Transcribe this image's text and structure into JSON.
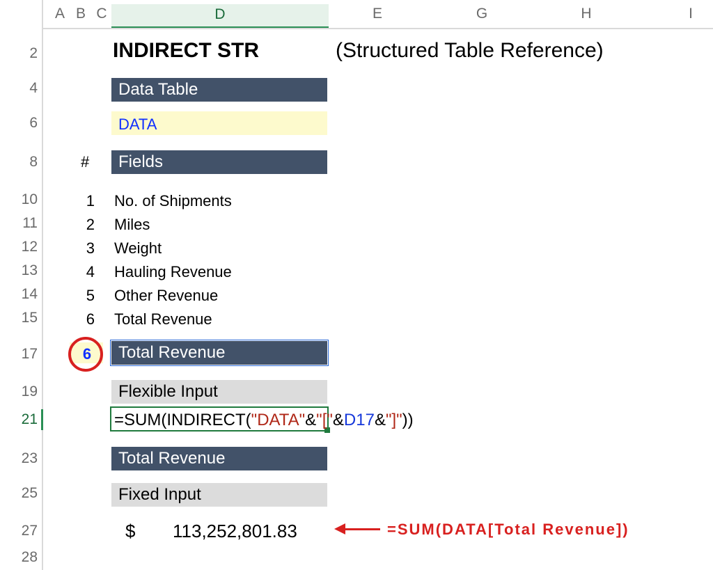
{
  "columns": {
    "A": "A",
    "B": "B",
    "C": "C",
    "D": "D",
    "E": "E",
    "G": "G",
    "H": "H",
    "I": "I"
  },
  "rows": {
    "r2": "2",
    "r4": "4",
    "r6": "6",
    "r8": "8",
    "r10": "10",
    "r11": "11",
    "r12": "12",
    "r13": "13",
    "r14": "14",
    "r15": "15",
    "r17": "17",
    "r19": "19",
    "r21": "21",
    "r23": "23",
    "r25": "25",
    "r27": "27",
    "r28": "28"
  },
  "title": {
    "bold": "INDIRECT STR",
    "regular": "(Structured Table Reference)"
  },
  "section": {
    "data_table": "Data Table",
    "data_name": "DATA",
    "fields_hdr": "Fields",
    "fields_num_hdr": "#"
  },
  "fields": {
    "nums": {
      "n1": "1",
      "n2": "2",
      "n3": "3",
      "n4": "4",
      "n5": "5",
      "n6": "6"
    },
    "items": {
      "f1": "No. of Shipments",
      "f2": "Miles",
      "f3": "Weight",
      "f4": "Hauling Revenue",
      "f5": "Other Revenue",
      "f6": "Total Revenue"
    }
  },
  "selected_field_num": "6",
  "selected_field_name": "Total Revenue",
  "flex_label": "Flexible Input",
  "formula": {
    "p1": "=SUM(",
    "p2": "INDIRECT(",
    "p3": "\"DATA\"",
    "amp1": "&",
    "p4": "\"[\"",
    "amp2": "&",
    "ref": "D17",
    "amp3": "&",
    "p5": "\"]\"",
    "close_ind": ")",
    "close_sum": ")"
  },
  "section2": {
    "total_rev": "Total Revenue",
    "fixed_label": "Fixed Input"
  },
  "result": {
    "currency": "$",
    "value": "113,252,801.83"
  },
  "annotation": {
    "text": "=SUM(DATA[Total Revenue])"
  }
}
